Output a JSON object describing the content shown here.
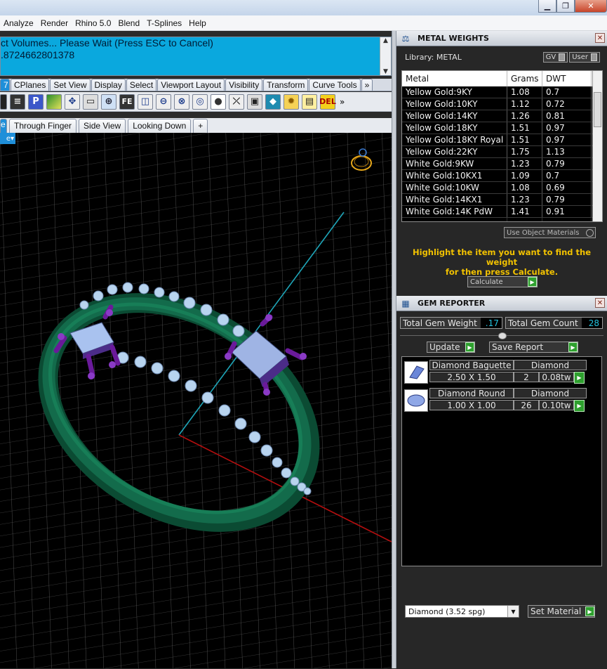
{
  "menubar": {
    "items": [
      "Analyze",
      "Render",
      "Rhino 5.0",
      "Blend",
      "T-Splines",
      "Help"
    ]
  },
  "window": {
    "minimize": "▁",
    "maximize": "❐",
    "close": "✕"
  },
  "command": {
    "line1": "ct Volumes... Please Wait (Press ESC to Cancel)",
    "line2": ".8724662801378",
    "input_value": ""
  },
  "toolbar_tabs": [
    "7",
    "CPlanes",
    "Set View",
    "Display",
    "Select",
    "Viewport Layout",
    "Visibility",
    "Transform",
    "Curve Tools",
    "»"
  ],
  "view_tabs": [
    "e",
    "Through Finger",
    "Side View",
    "Looking Down",
    "+"
  ],
  "viewport_label": "e",
  "metal_weights": {
    "title": "METAL WEIGHTS",
    "library_label": "Library: METAL",
    "gv_label": "GV",
    "user_label": "User",
    "columns": [
      "Metal",
      "Grams",
      "DWT"
    ],
    "rows": [
      [
        "Yellow Gold:9KY",
        "1.08",
        "0.7"
      ],
      [
        "Yellow Gold:10KY",
        "1.12",
        "0.72"
      ],
      [
        "Yellow Gold:14KY",
        "1.26",
        "0.81"
      ],
      [
        "Yellow Gold:18KY",
        "1.51",
        "0.97"
      ],
      [
        "Yellow Gold:18KY Royal",
        "1.51",
        "0.97"
      ],
      [
        "Yellow Gold:22KY",
        "1.75",
        "1.13"
      ],
      [
        "White Gold:9KW",
        "1.23",
        "0.79"
      ],
      [
        "White Gold:10KX1",
        "1.09",
        "0.7"
      ],
      [
        "White Gold:10KW",
        "1.08",
        "0.69"
      ],
      [
        "White Gold:14KX1",
        "1.23",
        "0.79"
      ],
      [
        "White Gold:14K PdW",
        "1.41",
        "0.91"
      ]
    ],
    "use_object_materials": "Use Object Materials",
    "hint_line1": "Highlight the item you want to find the weight",
    "hint_line2": "for then press Calculate.",
    "calculate_label": "Calculate"
  },
  "gem_reporter": {
    "title": "GEM REPORTER",
    "total_weight_label": "Total Gem Weight",
    "total_weight_value": ".17",
    "total_count_label": "Total Gem Count",
    "total_count_value": "28",
    "update_label": "Update",
    "save_report_label": "Save Report",
    "gems": [
      {
        "name": "Diamond Baguette",
        "material": "Diamond",
        "size": "2.50 X 1.50",
        "count": "2",
        "weight": "0.08tw"
      },
      {
        "name": "Diamond Round",
        "material": "Diamond",
        "size": "1.00 X 1.00",
        "count": "26",
        "weight": "0.10tw"
      }
    ],
    "material_select": "Diamond     (3.52 spg)",
    "set_material_label": "Set Material"
  },
  "colors": {
    "command_bg": "#0aa8de",
    "accent_blue": "#1f8fd9",
    "hint_yellow": "#f2c200",
    "value_cyan": "#24c4e0",
    "ring_green": "#0f5c3f",
    "prong_purple": "#6a1a9a"
  }
}
